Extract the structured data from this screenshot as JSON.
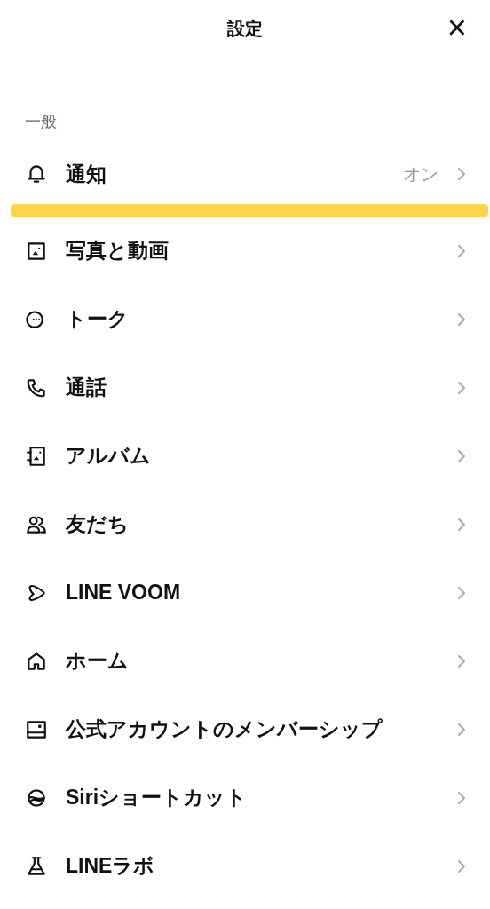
{
  "header": {
    "title": "設定",
    "close": "×"
  },
  "section": {
    "title": "一般",
    "items": [
      {
        "kind": "bell",
        "label": "通知",
        "value": "オン",
        "highlighted": true
      },
      {
        "kind": "photo",
        "label": "写真と動画",
        "highlighted": false
      },
      {
        "kind": "chat",
        "label": "トーク",
        "highlighted": false
      },
      {
        "kind": "phone",
        "label": "通話",
        "highlighted": false
      },
      {
        "kind": "album",
        "label": "アルバム",
        "highlighted": false
      },
      {
        "kind": "friends",
        "label": "友だち",
        "highlighted": false
      },
      {
        "kind": "play",
        "label": "LINE VOOM",
        "highlighted": false
      },
      {
        "kind": "home",
        "label": "ホーム",
        "highlighted": false
      },
      {
        "kind": "card",
        "label": "公式アカウントのメンバーシップ",
        "highlighted": false
      },
      {
        "kind": "siri",
        "label": "Siriショートカット",
        "highlighted": false
      },
      {
        "kind": "flask",
        "label": "LINEラボ",
        "highlighted": false
      }
    ]
  }
}
